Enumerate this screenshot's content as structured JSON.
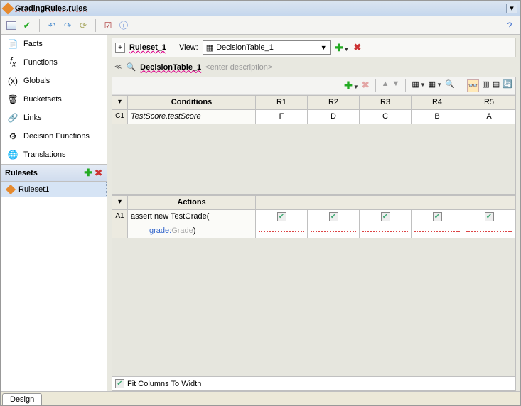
{
  "title": "GradingRules.rules",
  "sidebar": {
    "items": [
      {
        "label": "Facts",
        "icon": "facts"
      },
      {
        "label": "Functions",
        "icon": "fx"
      },
      {
        "label": "Globals",
        "icon": "x"
      },
      {
        "label": "Bucketsets",
        "icon": "bucket"
      },
      {
        "label": "Links",
        "icon": "link"
      },
      {
        "label": "Decision Functions",
        "icon": "gear"
      },
      {
        "label": "Translations",
        "icon": "globe"
      }
    ],
    "rulesets_label": "Rulesets",
    "ruleset_items": [
      "Ruleset1"
    ]
  },
  "ruleset": {
    "name": "Ruleset_1",
    "view_label": "View:",
    "view_value": "DecisionTable_1"
  },
  "decision_table": {
    "name": "DecisionTable_1",
    "desc_placeholder": "<enter description>",
    "conditions_label": "Conditions",
    "actions_label": "Actions",
    "rule_headers": [
      "R1",
      "R2",
      "R3",
      "R4",
      "R5"
    ],
    "conditions": [
      {
        "id": "C1",
        "expr": "TestScore.testScore",
        "values": [
          "F",
          "D",
          "C",
          "B",
          "A"
        ]
      }
    ],
    "actions": [
      {
        "id": "A1",
        "expr": "assert new TestGrade(",
        "param_label": "grade:",
        "param_value": "Grade",
        "checks": [
          true,
          true,
          true,
          true,
          true
        ]
      }
    ],
    "fit_label": "Fit Columns To Width",
    "fit_checked": true
  },
  "bottom_tab": "Design"
}
